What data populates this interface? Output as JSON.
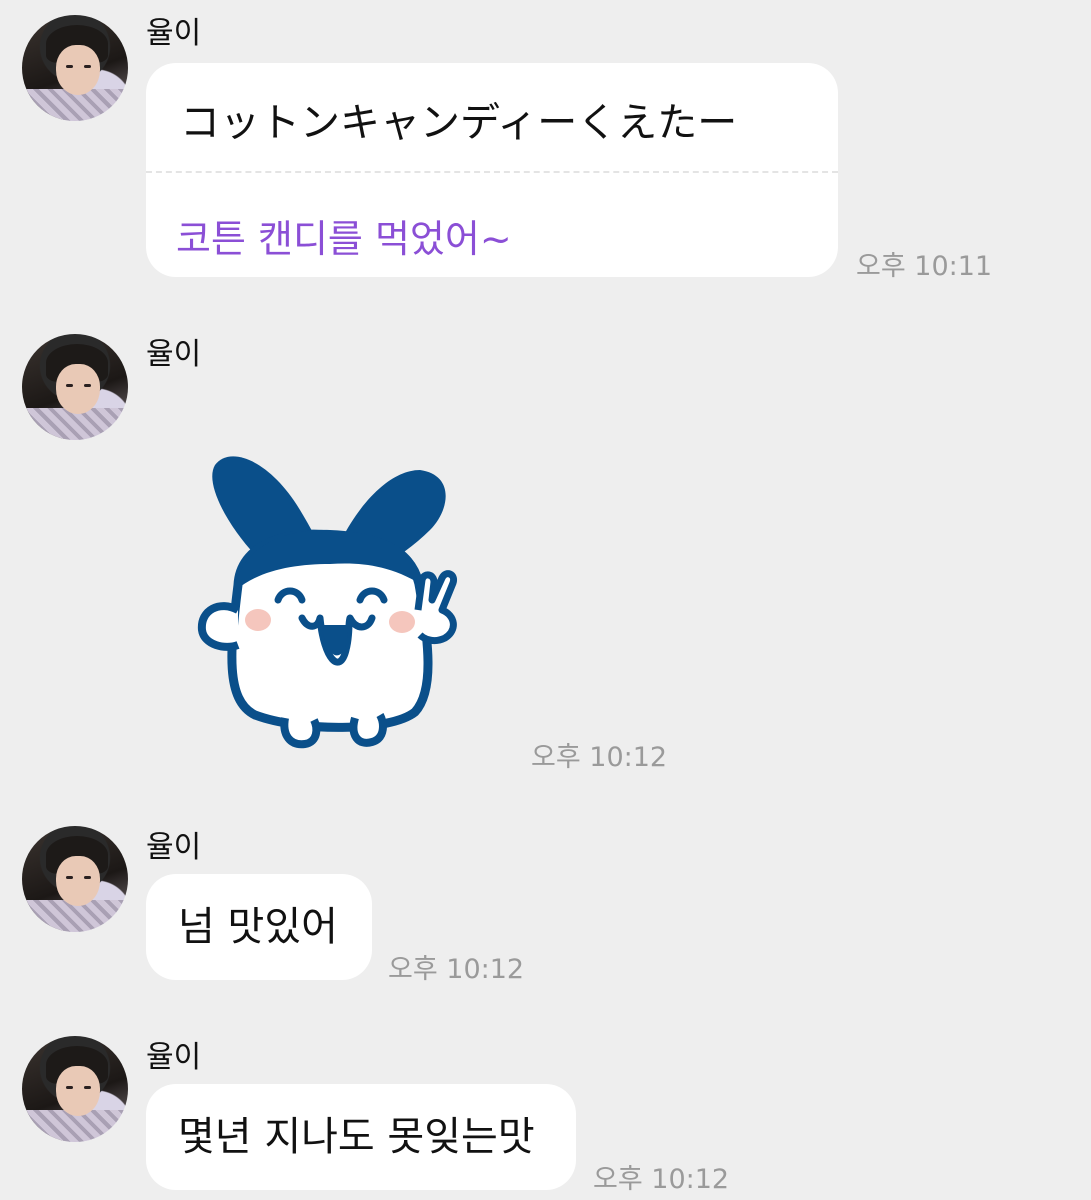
{
  "messages": [
    {
      "sender": "율이",
      "text": "コットンキャンディーくえたー",
      "translation": "코튼 캔디를 먹었어~",
      "time": "오후 10:11"
    },
    {
      "sender": "율이",
      "sticker": "tamagotchi-character-sticker",
      "time": "오후 10:12"
    },
    {
      "sender": "율이",
      "text": "넘 맛있어",
      "time": "오후 10:12"
    },
    {
      "sender": "율이",
      "text": "몇년 지나도 못잊는맛",
      "time": "오후 10:12"
    }
  ],
  "colors": {
    "background": "#eeeeee",
    "bubble": "#ffffff",
    "translation": "#8b4fd6",
    "timestamp": "#9a9a9a",
    "sticker_blue": "#0a4f8a",
    "sticker_cheek": "#f5c6bd"
  }
}
